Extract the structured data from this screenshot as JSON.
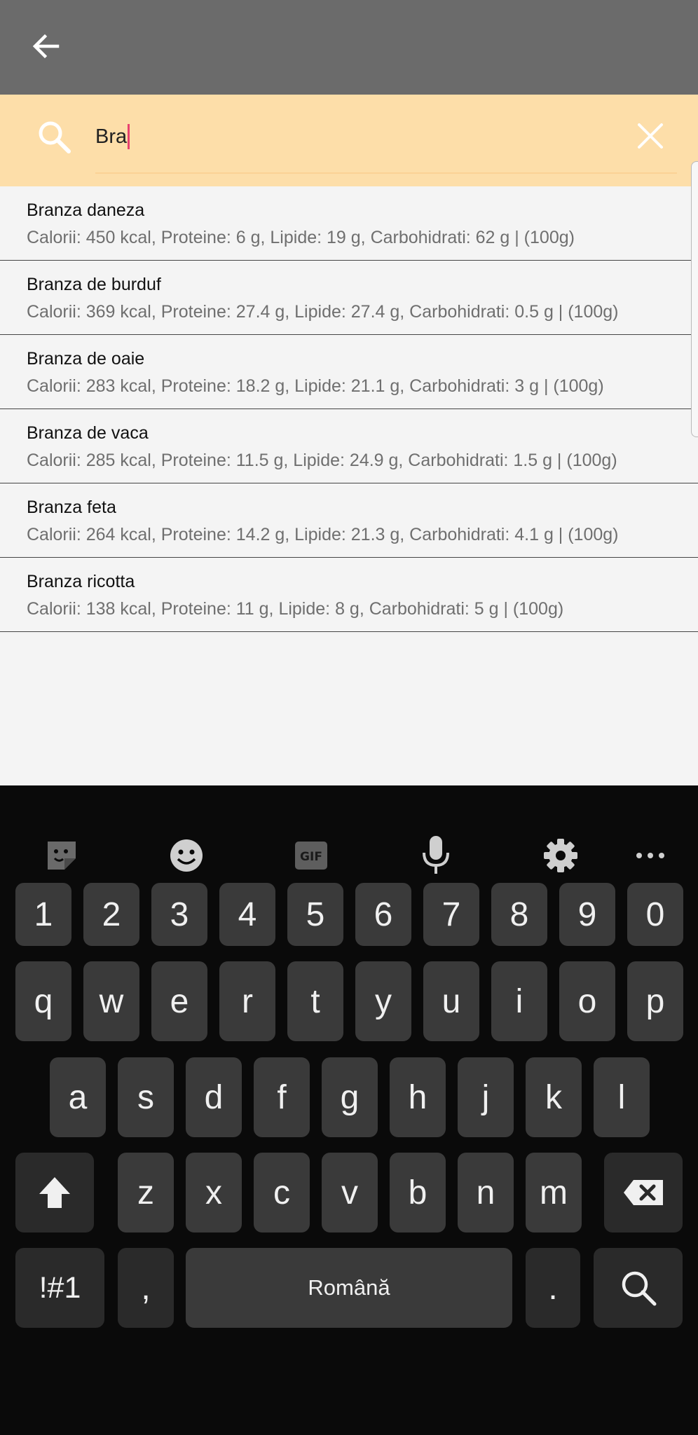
{
  "search": {
    "value": "Bra"
  },
  "results": [
    {
      "name": "Branza daneza",
      "details": "Calorii: 450 kcal, Proteine: 6 g, Lipide: 19 g, Carbohidrati: 62 g | (100g)"
    },
    {
      "name": "Branza de burduf",
      "details": "Calorii: 369 kcal, Proteine: 27.4 g, Lipide: 27.4 g, Carbohidrati: 0.5 g | (100g)"
    },
    {
      "name": "Branza de oaie",
      "details": "Calorii: 283 kcal, Proteine: 18.2 g, Lipide: 21.1 g, Carbohidrati: 3 g | (100g)"
    },
    {
      "name": "Branza de vaca",
      "details": "Calorii: 285 kcal, Proteine: 11.5 g, Lipide: 24.9 g, Carbohidrati: 1.5 g | (100g)"
    },
    {
      "name": "Branza feta",
      "details": "Calorii: 264 kcal, Proteine: 14.2 g, Lipide: 21.3 g, Carbohidrati: 4.1 g | (100g)"
    },
    {
      "name": "Branza ricotta",
      "details": "Calorii: 138 kcal, Proteine: 11 g, Lipide: 8 g, Carbohidrati: 5 g | (100g)"
    }
  ],
  "keyboard": {
    "toolbar_icons": [
      "sticker-icon",
      "emoji-icon",
      "gif-icon",
      "microphone-icon",
      "settings-icon",
      "more-icon"
    ],
    "gif_label": "GIF",
    "row_numbers": [
      "1",
      "2",
      "3",
      "4",
      "5",
      "6",
      "7",
      "8",
      "9",
      "0"
    ],
    "row_top": [
      "q",
      "w",
      "e",
      "r",
      "t",
      "y",
      "u",
      "i",
      "o",
      "p"
    ],
    "row_middle": [
      "a",
      "s",
      "d",
      "f",
      "g",
      "h",
      "j",
      "k",
      "l"
    ],
    "row_bottom": [
      "z",
      "x",
      "c",
      "v",
      "b",
      "n",
      "m"
    ],
    "symbols_label": "!#1",
    "comma_label": ",",
    "space_label": "Română",
    "period_label": "."
  },
  "colors": {
    "toolbar": "#6b6b6b",
    "search_bar": "#fddea9",
    "caret": "#e8416f",
    "keyboard_bg": "#0a0a0a",
    "key_bg": "#3a3a3a"
  }
}
